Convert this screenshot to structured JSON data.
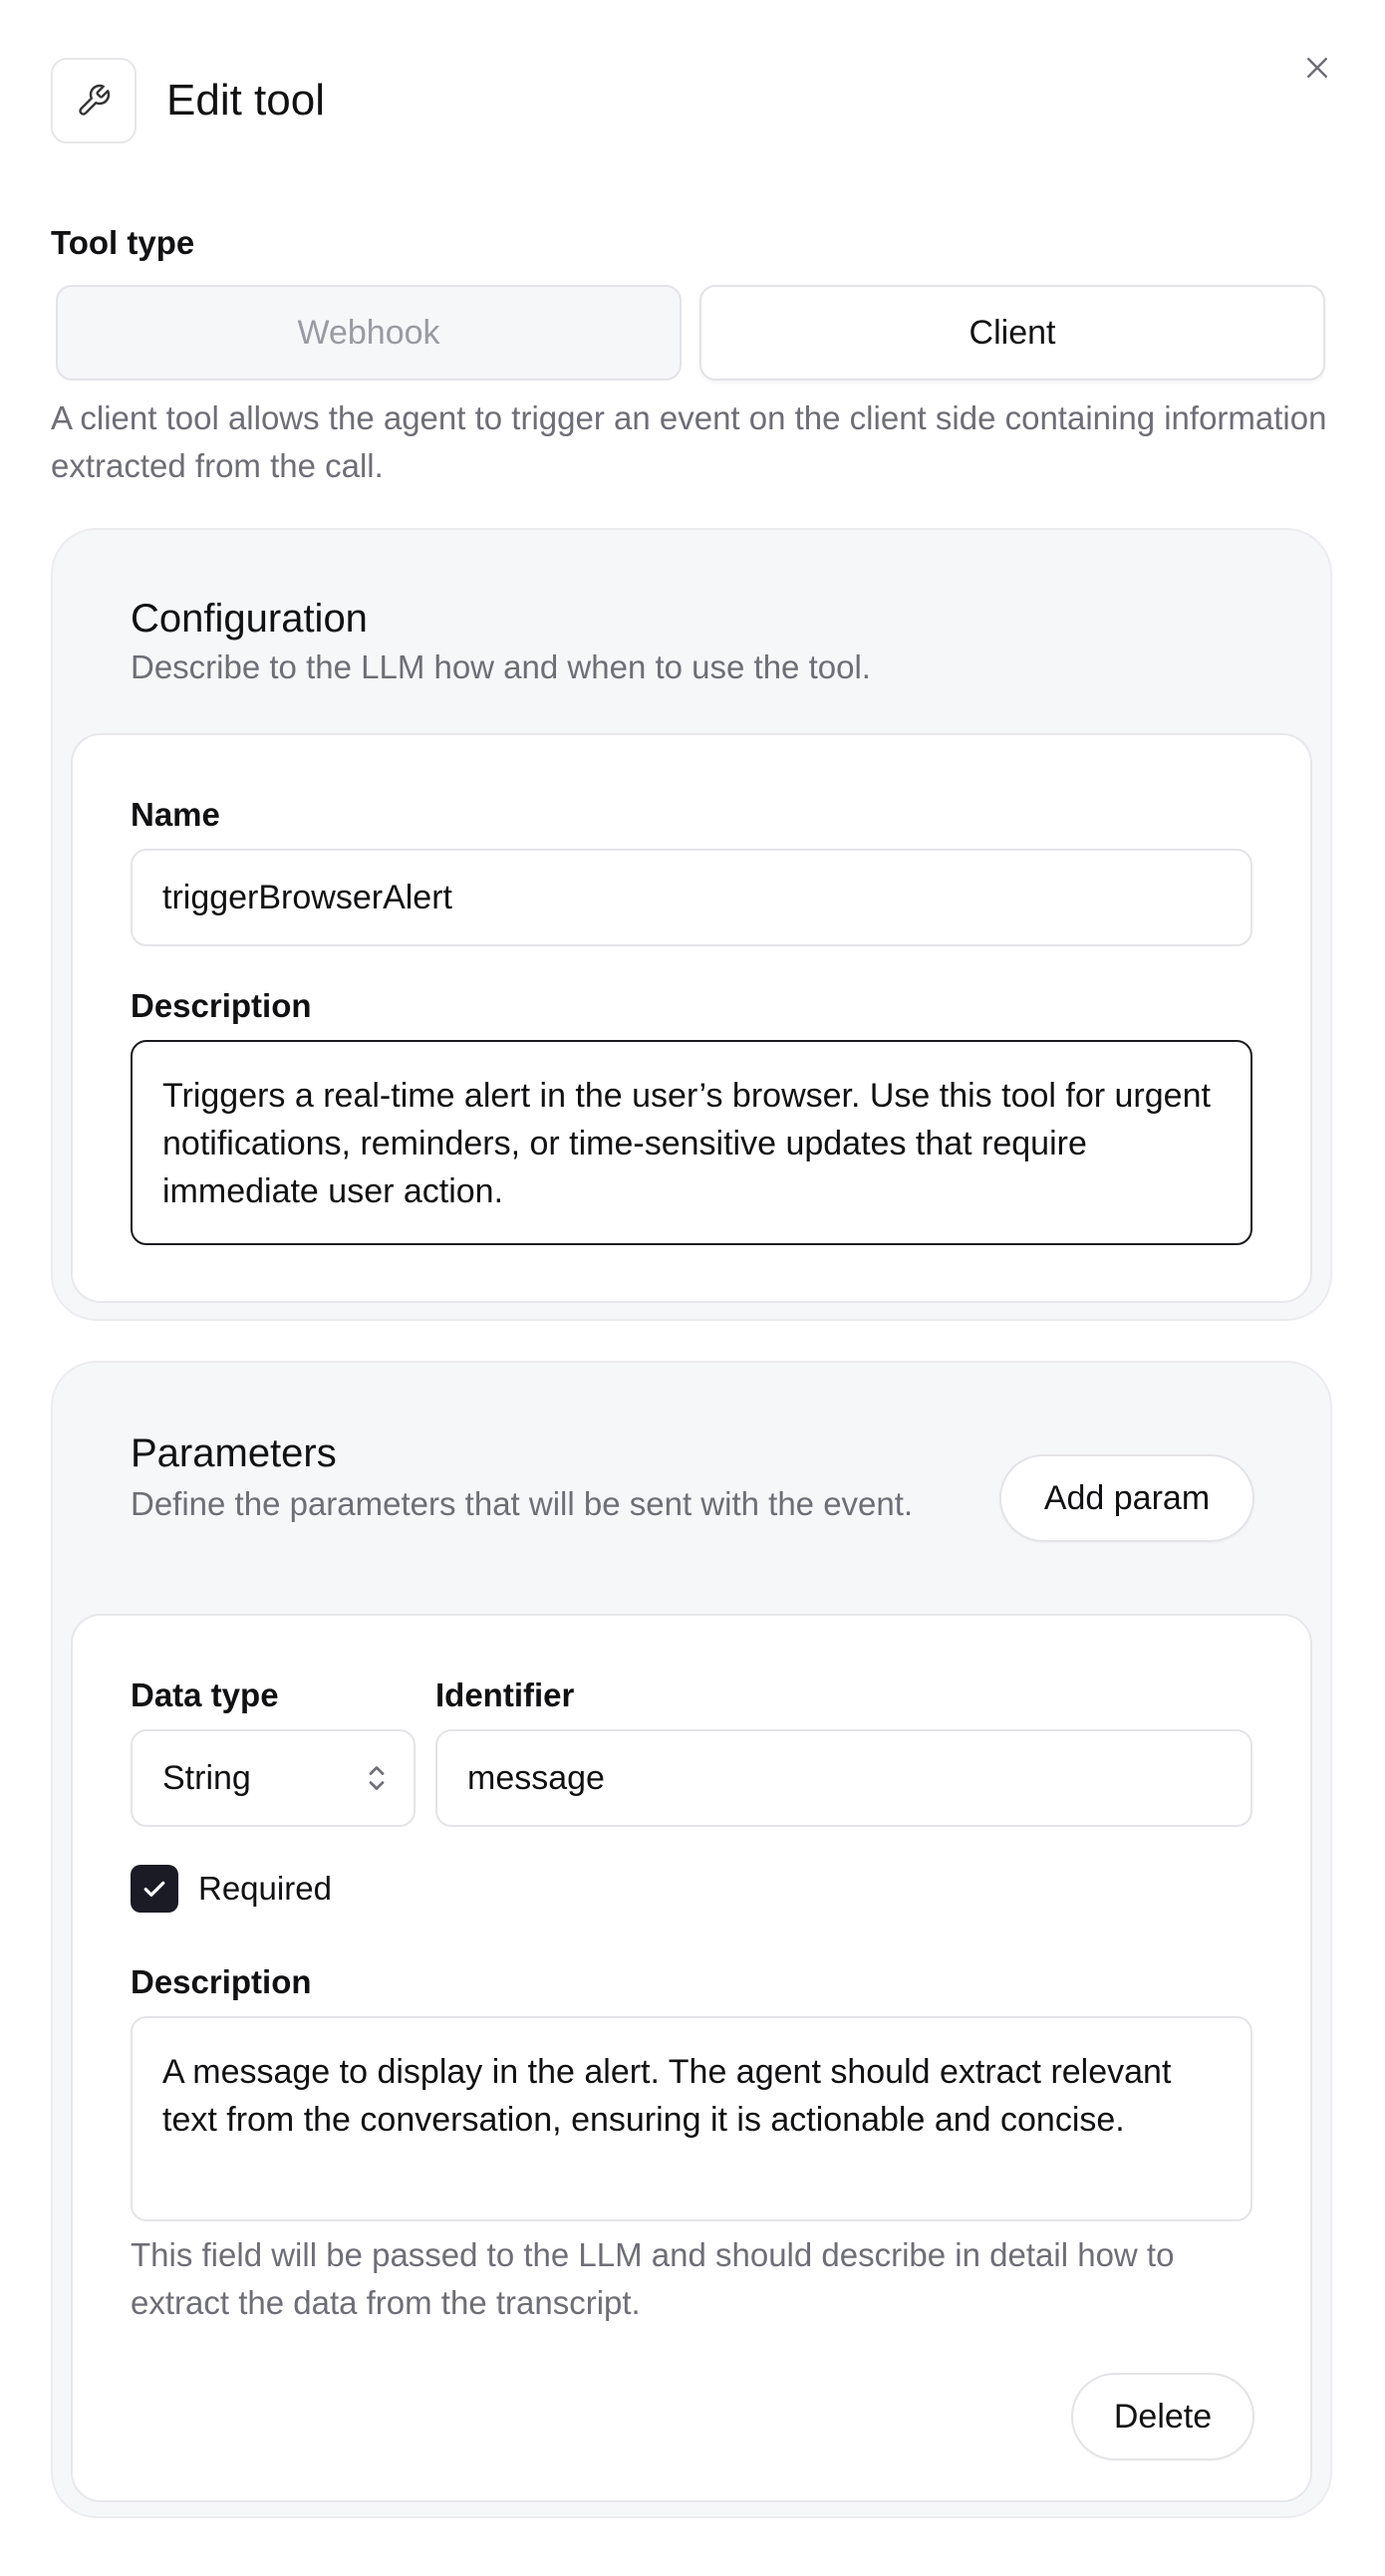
{
  "header": {
    "title": "Edit tool"
  },
  "tool_type": {
    "label": "Tool type",
    "options": [
      "Webhook",
      "Client"
    ],
    "selected": "Client",
    "description": "A client tool allows the agent to trigger an event on the client side containing information extracted from the call."
  },
  "configuration": {
    "title": "Configuration",
    "subtitle": "Describe to the LLM how and when to use the tool.",
    "name_label": "Name",
    "name_value": "triggerBrowserAlert",
    "description_label": "Description",
    "description_value": "Triggers a real-time alert in the user’s browser. Use this tool for urgent notifications, reminders, or time-sensitive updates that require immediate user action."
  },
  "parameters": {
    "title": "Parameters",
    "subtitle": "Define the parameters that will be sent with the event.",
    "add_label": "Add param",
    "items": [
      {
        "data_type_label": "Data type",
        "data_type_value": "String",
        "identifier_label": "Identifier",
        "identifier_value": "message",
        "required_label": "Required",
        "required": true,
        "description_label": "Description",
        "description_value": "A message to display in the alert. The agent should extract relevant text from the conversation, ensuring it is actionable and concise.",
        "help_text": "This field will be passed to the LLM and should describe in detail how to extract the data from the transcript.",
        "delete_label": "Delete"
      }
    ]
  },
  "colors": {
    "accent": "#1b1b26",
    "panel_bg": "#f6f7f9",
    "muted_text": "#6e6e76"
  }
}
